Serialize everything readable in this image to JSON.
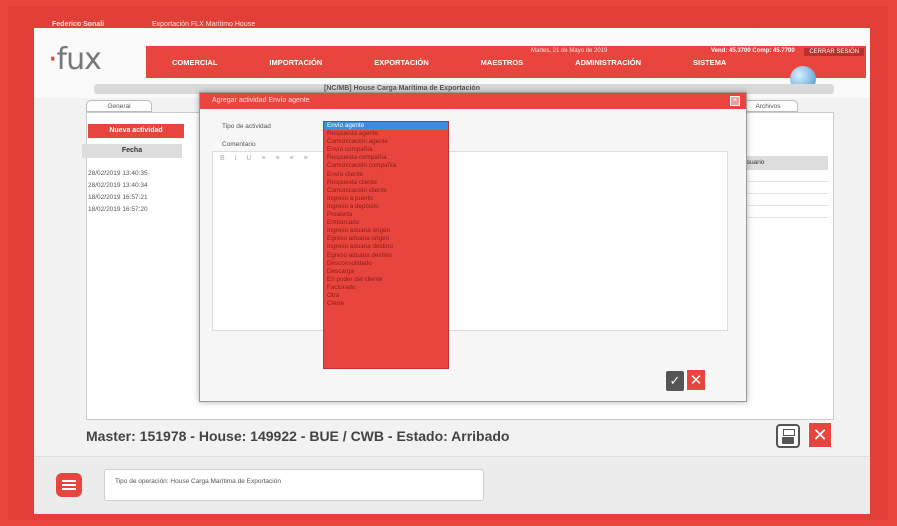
{
  "topbar": {
    "user": "Federico Sonali",
    "crumb": "Exportación FLX Marítimo House",
    "date": "Martes, 21 de Mayo de 2019",
    "rates": "Vend: 45.3700 Comp: 45.7700",
    "logout": "CERRAR SESIÓN"
  },
  "header": {
    "logo": "fux",
    "menu": [
      "COMERCIAL",
      "IMPORTACIÓN",
      "EXPORTACIÓN",
      "MAESTROS",
      "ADMINISTRACIÓN",
      "SISTEMA"
    ],
    "subtitle": "[NC/MB] House Carga Marítima de Exportación"
  },
  "tabs": {
    "general": "General",
    "archivos": "Archivos"
  },
  "activities": {
    "new_label": "Nueva actividad",
    "date_header": "Fecha",
    "dates": [
      "28/02/2019 13:40:35",
      "28/02/2019 13:40:34",
      "18/02/2019 16:57:21",
      "18/02/2019 16:57:20"
    ],
    "right_header": "Usuario"
  },
  "modal": {
    "title": "Agregar actividad Envío agente",
    "type_label": "Tipo de actividad",
    "comment_label": "Comentario",
    "toolbar": "B I U ≡ ≡ ≡ ≡",
    "options": [
      "Envío agente",
      "Respuesta agente",
      "Comunicación agente",
      "Envío compañía",
      "Respuesta compañía",
      "Comunicación compañía",
      "Envío cliente",
      "Respuesta cliente",
      "Comunicación cliente",
      "Ingreso a puerto",
      "Ingreso a depósito",
      "Prealerta",
      "Embarcado",
      "Ingreso aduana origen",
      "Egreso aduana origen",
      "Ingreso aduana destino",
      "Egreso aduana destino",
      "Desconsolidado",
      "Descarga",
      "En poder del cliente",
      "Facturado",
      "Otra",
      "Cierre"
    ],
    "selected_index": 0,
    "ok_symbol": "✓",
    "cancel_symbol": "✕"
  },
  "status": {
    "master_line": "Master: 151978 - House: 149922 - BUE / CWB - Estado: Arribado"
  },
  "footer": {
    "optype": "Tipo de operación: House Carga Marítima de Exportación"
  },
  "colors": {
    "accent": "#e8453e",
    "selected": "#3a8fd8"
  }
}
